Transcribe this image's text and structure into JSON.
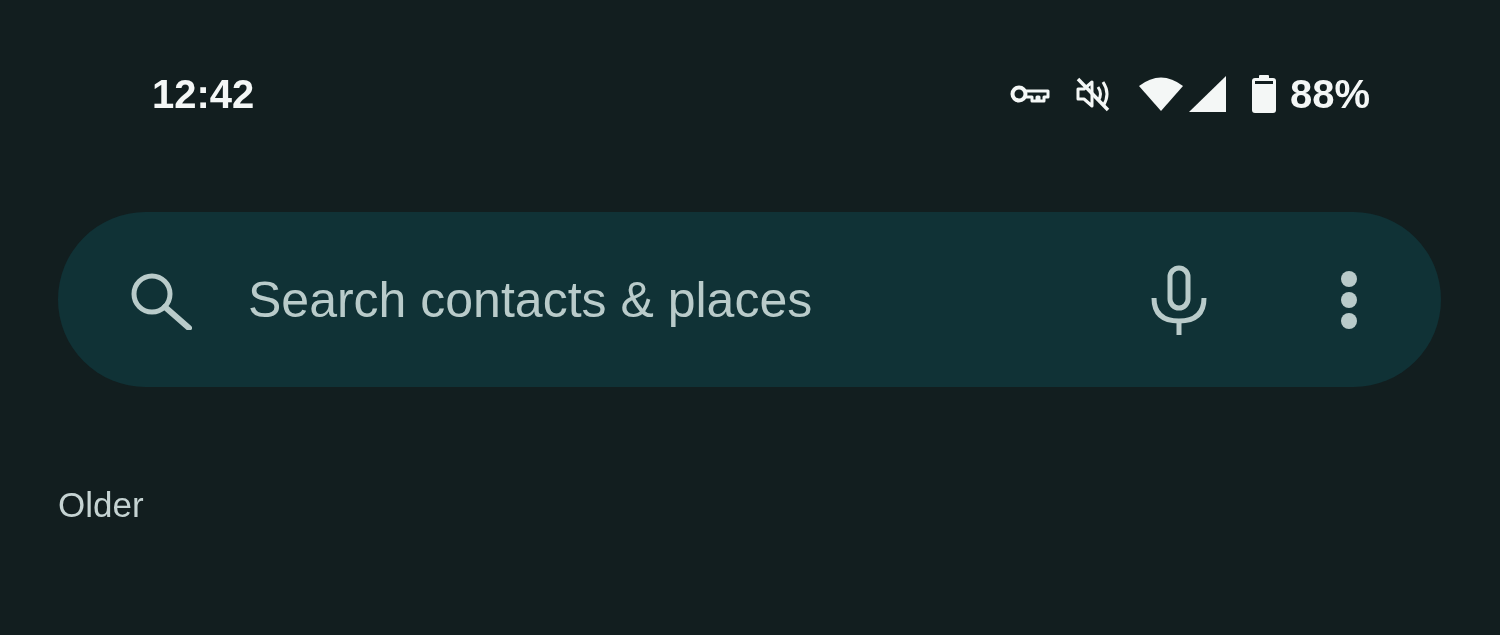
{
  "status_bar": {
    "time": "12:42",
    "battery_percent": "88%"
  },
  "search": {
    "placeholder": "Search contacts & places"
  },
  "section_header": "Older"
}
